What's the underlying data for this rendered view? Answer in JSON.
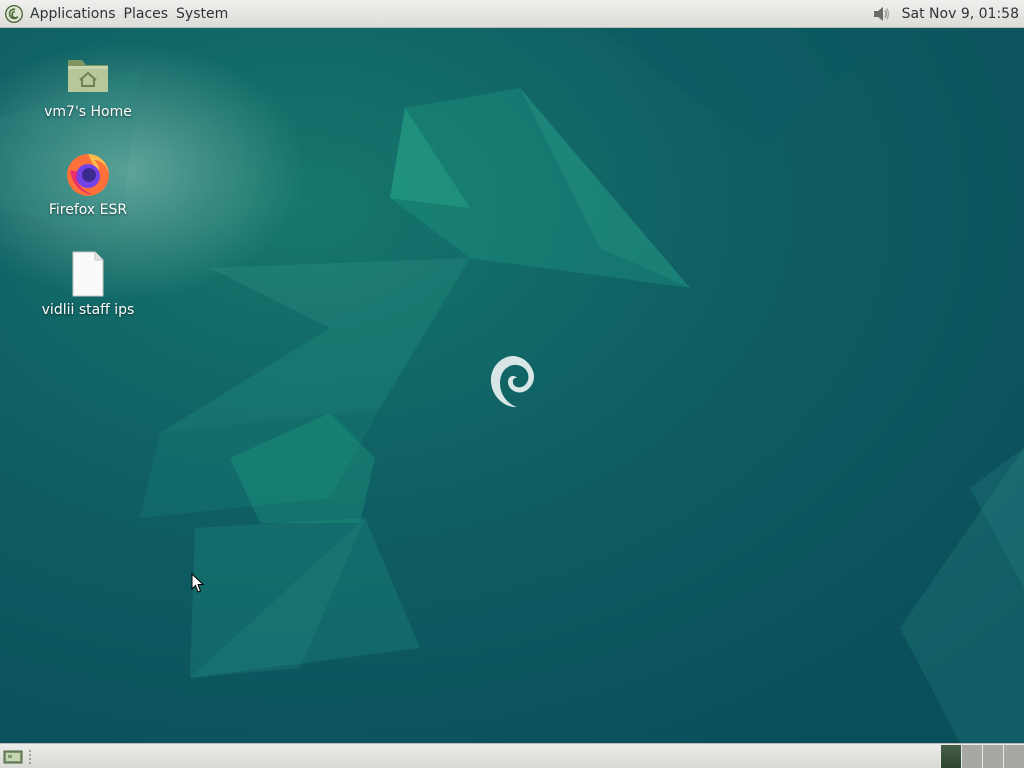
{
  "top_panel": {
    "menus": {
      "applications": "Applications",
      "places": "Places",
      "system": "System"
    },
    "clock": "Sat Nov 9, 01:58",
    "icons": {
      "app_menu_logo": "debian-logo-icon",
      "volume": "speaker-icon"
    }
  },
  "desktop": {
    "icons": [
      {
        "label": "vm7's Home",
        "icon": "home-folder-icon"
      },
      {
        "label": "Firefox ESR",
        "icon": "firefox-icon"
      },
      {
        "label": "vidlii staff ips",
        "icon": "text-file-icon"
      }
    ],
    "wallpaper": {
      "logo": "debian-swirl-icon",
      "base_color": "#0d5660"
    }
  },
  "bottom_panel": {
    "show_desktop_icon": "show-desktop-icon",
    "workspaces": [
      {
        "active": true
      },
      {
        "active": false
      },
      {
        "active": false
      },
      {
        "active": false
      }
    ]
  }
}
